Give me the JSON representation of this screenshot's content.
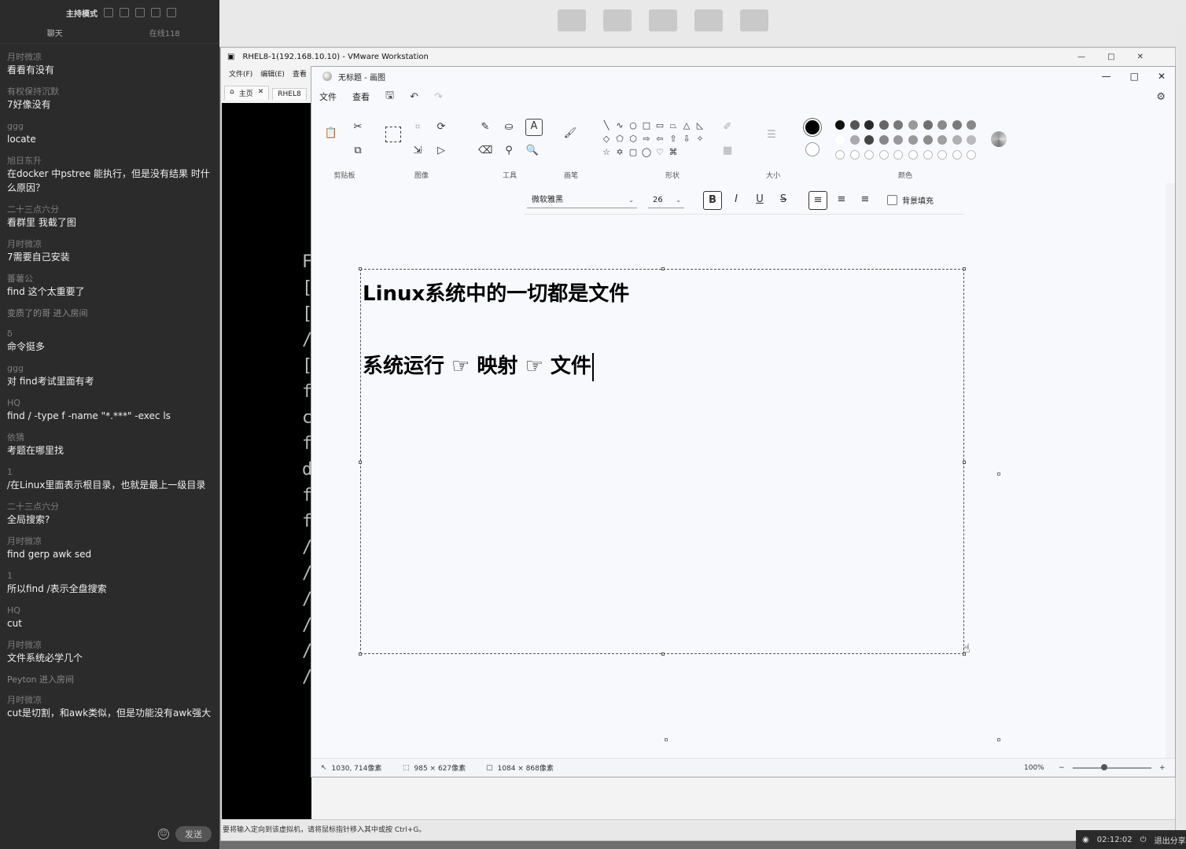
{
  "chat": {
    "title": "主持模式",
    "tabs": [
      "聊天",
      "在线118"
    ],
    "messages": [
      {
        "name": "月时微凉",
        "text": "看看有没有"
      },
      {
        "name": "有权保持沉默",
        "text": "7好像没有"
      },
      {
        "name": "ggg",
        "text": "locate"
      },
      {
        "name": "旭日东升",
        "text": "在docker 中pstree 能执行，但是没有结果 时什么原因？"
      },
      {
        "name": "二十三点六分",
        "text": "看群里   我截了图"
      },
      {
        "name": "月时微凉",
        "text": "7需要自己安装"
      },
      {
        "name": "蕃薯公",
        "text": "find  这个太重要了"
      },
      {
        "name": "变质了的哥 进入房间",
        "text": ""
      },
      {
        "name": "δ",
        "text": "命令挺多"
      },
      {
        "name": "ggg",
        "text": "对  find考试里面有考"
      },
      {
        "name": "HQ",
        "text": "find / -type f -name \"*.***\" -exec ls"
      },
      {
        "name": "依猜",
        "text": "考题在哪里找"
      },
      {
        "name": "1",
        "text": "/在Linux里面表示根目录，也就是最上一级目录"
      },
      {
        "name": "二十三点六分",
        "text": "全局搜索?"
      },
      {
        "name": "月时微凉",
        "text": "find   gerp  awk  sed"
      },
      {
        "name": "1",
        "text": "所以find /表示全盘搜索"
      },
      {
        "name": "HQ",
        "text": "cut"
      },
      {
        "name": "月时微凉",
        "text": "文件系统必学几个"
      },
      {
        "name": "Peyton 进入房间",
        "text": ""
      },
      {
        "name": "月时微凉",
        "text": "cut是切割，和awk类似，但是功能没有awk强大"
      }
    ],
    "send_label": "发送"
  },
  "desktop": {
    "icons": [
      "​",
      "​",
      "​",
      "​",
      "​"
    ]
  },
  "vmware": {
    "title": "RHEL8-1(192.168.10.10) - VMware Workstation",
    "menu": [
      "文件(F)",
      "编辑(E)",
      "查看"
    ],
    "tabs": [
      "主页",
      "RHEL8"
    ],
    "console_chars": [
      "F",
      "[",
      "[",
      "/",
      "[",
      "f",
      "c",
      "f",
      "d",
      "f",
      "f",
      "/",
      "/",
      "/",
      "/",
      "/",
      "/"
    ],
    "status_text": "要将输入定向到该虚拟机，请将鼠标指针移入其中或按 Ctrl+G。"
  },
  "paint": {
    "title": "无标题 - 画图",
    "menu": [
      "文件",
      "查看"
    ],
    "groups": [
      "剪贴板",
      "图像",
      "工具",
      "画笔",
      "形状",
      "大小",
      "颜色"
    ],
    "font": "微软雅黑",
    "font_size": "26",
    "bg_fill_label": "背景填充",
    "canvas_line1": "Linux系统中的一切都是文件",
    "canvas_line2": "系统运行 ☞  映射 ☞ 文件",
    "status": {
      "cursor_pos": "1030, 714像素",
      "selection_size": "985 × 627像素",
      "canvas_size": "1084 × 868像素",
      "zoom": "100%"
    },
    "colors": {
      "primary": "#000000",
      "secondary": "#ffffff",
      "palette_row1": [
        "#111111",
        "#555555",
        "#2a2a2a",
        "#666666",
        "#777777",
        "#999999",
        "#6f6f6f",
        "#8a8a8a",
        "#7a7a7a",
        "#888888"
      ],
      "palette_row2": [
        "#ffffff",
        "#aaaaaa",
        "#444444",
        "#888888",
        "#999999",
        "#9a9a9a",
        "#8c8c8c",
        "#a0a0a0",
        "#b0b0b0",
        "#bbbbbb"
      ]
    }
  },
  "taskbar": {
    "time": "02:12:02",
    "exit_share": "退出分享"
  }
}
